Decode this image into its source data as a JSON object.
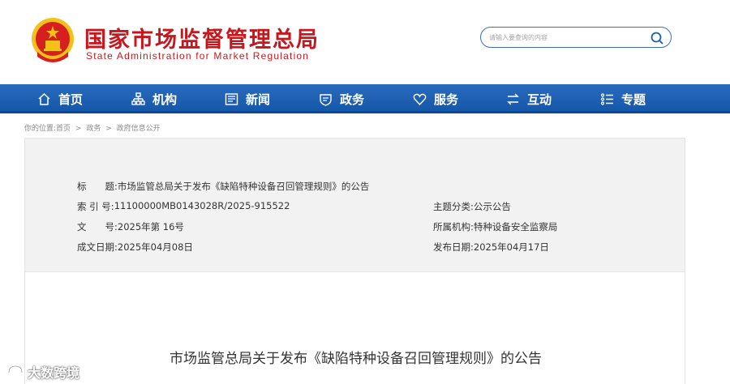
{
  "header": {
    "title_cn": "国家市场监督管理总局",
    "title_en": "State Administration for Market Regulation",
    "brand_color": "#c8161d"
  },
  "search": {
    "placeholder": "请输入要查询的内容",
    "icon": "search-icon"
  },
  "nav": {
    "items": [
      {
        "label": "首页",
        "icon": "home-icon"
      },
      {
        "label": "机构",
        "icon": "org-chart-icon"
      },
      {
        "label": "新闻",
        "icon": "newspaper-icon"
      },
      {
        "label": "政务",
        "icon": "shield-icon"
      },
      {
        "label": "服务",
        "icon": "heart-icon"
      },
      {
        "label": "互动",
        "icon": "swap-arrows-icon"
      },
      {
        "label": "专题",
        "icon": "list-icon"
      }
    ],
    "background": "#1b5fb0"
  },
  "breadcrumb": {
    "items": [
      "你的位置:首页",
      ">",
      "政务",
      ">",
      "政府信息公开"
    ]
  },
  "meta": {
    "title_label": "标　　题:",
    "title_value": "市场监管总局关于发布《缺陷特种设备召回管理规则》的公告",
    "index_label": "索 引 号:",
    "index_value": "11100000MB0143028R/2025-915522",
    "topic_label": "主题分类:",
    "topic_value": "公示公告",
    "doc_label": "文　　号:",
    "doc_value": "2025年第 16号",
    "agency_label": "所属机构:",
    "agency_value": "特种设备安全监察局",
    "created_label": "成文日期:",
    "created_value": "2025年04月08日",
    "published_label": "发布日期:",
    "published_value": "2025年04月17日"
  },
  "article": {
    "title": "市场监管总局关于发布《缺陷特种设备召回管理规则》的公告"
  },
  "watermark": {
    "text": "大数跨境",
    "icon": "brand-logo-icon"
  }
}
